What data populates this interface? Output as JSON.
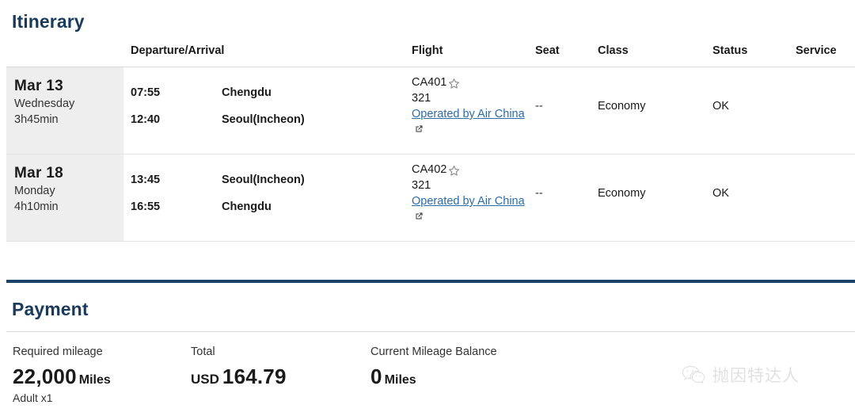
{
  "itinerary": {
    "title": "Itinerary",
    "columns": {
      "departure_arrival": "Departure/Arrival",
      "flight": "Flight",
      "seat": "Seat",
      "class": "Class",
      "status": "Status",
      "service": "Service"
    },
    "rows": [
      {
        "date": "Mar 13",
        "weekday": "Wednesday",
        "duration": "3h45min",
        "depart_time": "07:55",
        "depart_port": "Chengdu",
        "arrive_time": "12:40",
        "arrive_port": "Seoul(Incheon)",
        "flight_number": "CA401",
        "flight_badge_icon": "star-icon",
        "aircraft": "321",
        "operated_by": "Operated by Air China",
        "operated_by_icon": "external-link-icon",
        "seat": "--",
        "class": "Economy",
        "status": "OK",
        "service": ""
      },
      {
        "date": "Mar 18",
        "weekday": "Monday",
        "duration": "4h10min",
        "depart_time": "13:45",
        "depart_port": "Seoul(Incheon)",
        "arrive_time": "16:55",
        "arrive_port": "Chengdu",
        "flight_number": "CA402",
        "flight_badge_icon": "star-icon",
        "aircraft": "321",
        "operated_by": "Operated by Air China",
        "operated_by_icon": "external-link-icon",
        "seat": "--",
        "class": "Economy",
        "status": "OK",
        "service": ""
      }
    ]
  },
  "payment": {
    "title": "Payment",
    "required_mileage": {
      "label": "Required mileage",
      "amount": "22,000",
      "unit": "Miles",
      "passengers": "Adult x1"
    },
    "total": {
      "label": "Total",
      "currency": "USD",
      "amount": "164.79"
    },
    "current_balance": {
      "label": "Current Mileage Balance",
      "amount": "0",
      "unit": "Miles"
    }
  },
  "watermark": {
    "icon": "wechat-icon",
    "text": "抛因特达人"
  },
  "colors": {
    "heading_navy": "#1a3a5c",
    "divider_navy": "#1d4468",
    "link_blue": "#2c6ca8",
    "row_date_bg": "#eeeeee"
  }
}
